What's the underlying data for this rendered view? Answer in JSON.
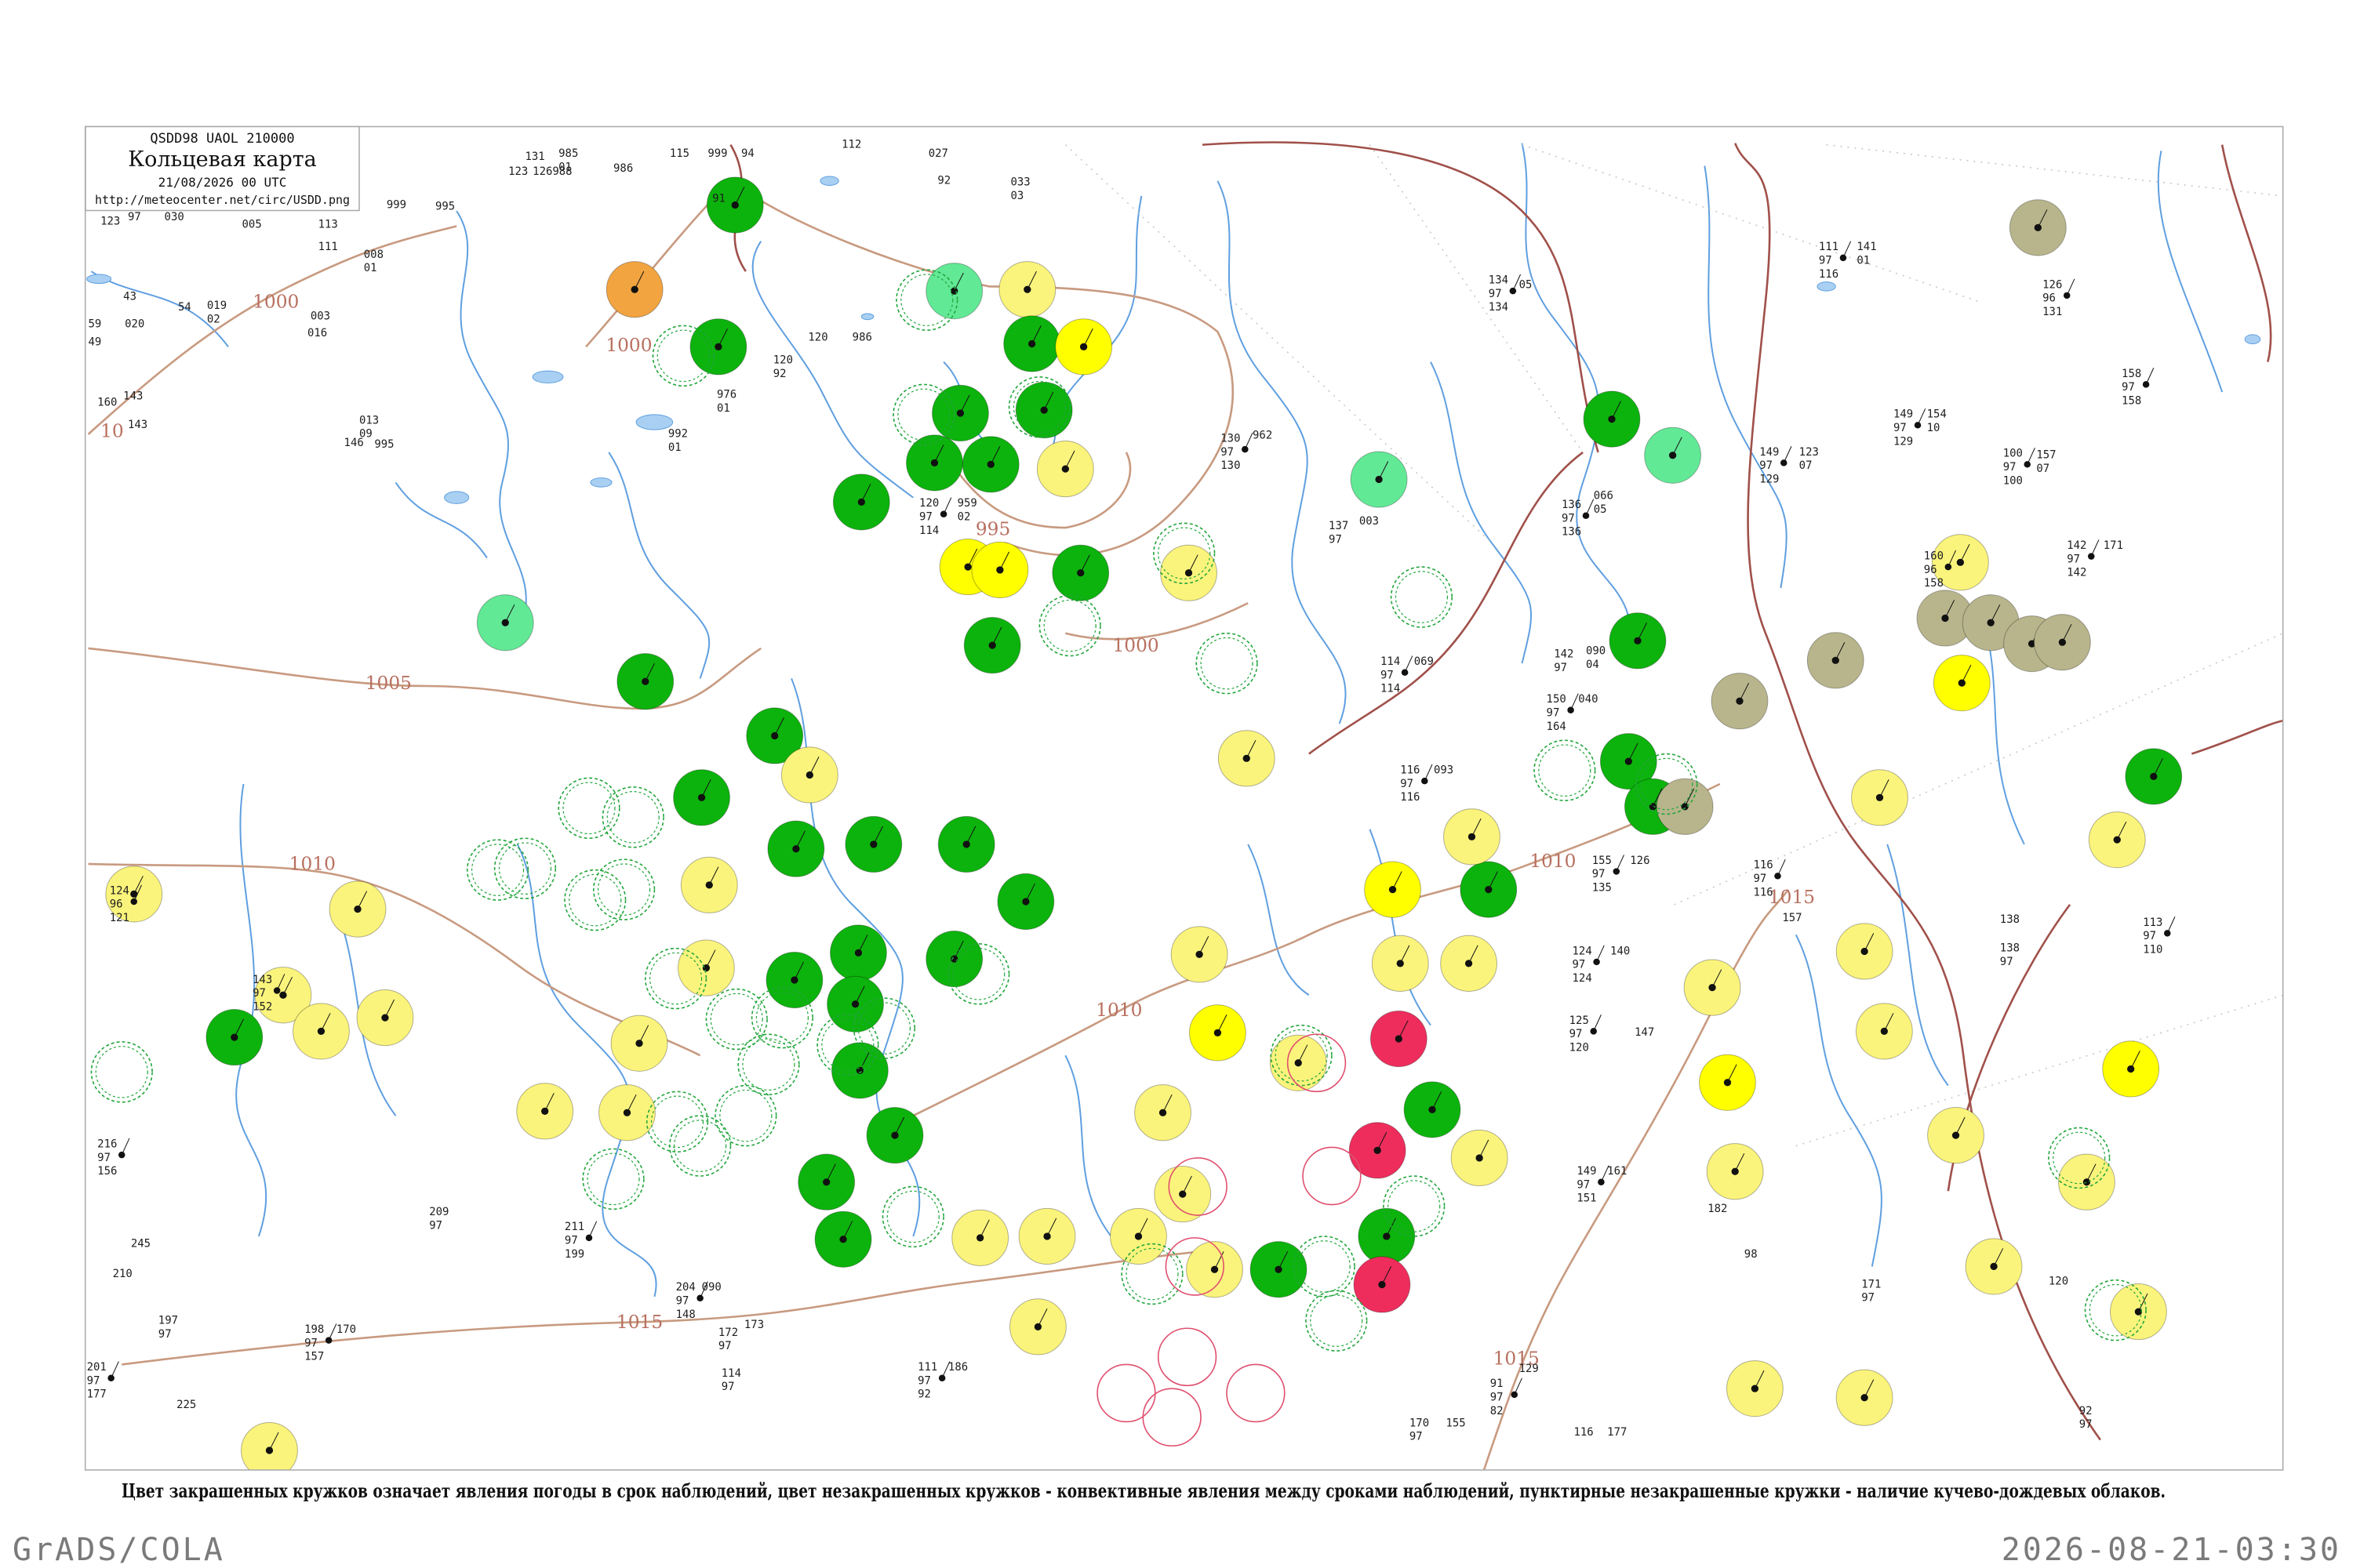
{
  "header": {
    "code": "QSDD98 UAOL 210000",
    "title": "Кольцевая карта",
    "date": "21/08/2026 00 UTC",
    "url": "http://meteocenter.net/circ/USDD.png"
  },
  "caption": "Цвет закрашенных кружков означает явления погоды в срок наблюдений, цвет незакрашенных кружков - конвективные явления между сроками наблюдений, пунктирные незакрашенные кружки - наличие кучево-дождевых облаков.",
  "footer": {
    "left": "GrADS/COLA",
    "right": "2026-08-21-03:30"
  },
  "colors": {
    "green": "#0cb30c",
    "lightgreen": "#62e996",
    "yellow": "#fbf47c",
    "bright": "#ffff00",
    "orange": "#f2a440",
    "red": "#ee2d5c",
    "olive": "#b8b58c",
    "dashed_green": "#22a63c",
    "open_red": "#e05070",
    "isobar": "#b87060"
  },
  "isobar_labels": [
    "1000",
    "10",
    "1000",
    "1005",
    "1010",
    "995",
    "1000",
    "1010",
    "1015",
    "1010",
    "1015",
    "1015"
  ],
  "filled_markers": [
    "green",
    "orange",
    "green",
    "lightgreen",
    "yellow",
    "green",
    "bright",
    "green",
    "green",
    "green",
    "green",
    "yellow",
    "green",
    "bright",
    "bright",
    "green",
    "green",
    "lightgreen",
    "green",
    "green",
    "green",
    "yellow",
    "green",
    "green",
    "green",
    "green",
    "green",
    "green",
    "green",
    "green",
    "green",
    "green",
    "green",
    "green",
    "yellow",
    "yellow",
    "yellow",
    "yellow",
    "yellow",
    "yellow",
    "yellow",
    "yellow",
    "green",
    "yellow",
    "yellow",
    "green",
    "lightgreen",
    "lightgreen",
    "olive",
    "yellow",
    "olive",
    "olive",
    "olive",
    "olive",
    "olive",
    "olive",
    "bright",
    "green",
    "green",
    "green",
    "olive",
    "green",
    "bright",
    "bright",
    "yellow",
    "yellow",
    "yellow",
    "yellow",
    "yellow",
    "yellow",
    "yellow",
    "yellow",
    "yellow",
    "green",
    "bright",
    "yellow",
    "yellow",
    "red",
    "red",
    "green",
    "green",
    "red",
    "green",
    "bright",
    "yellow",
    "yellow",
    "yellow",
    "yellow",
    "yellow",
    "yellow",
    "yellow",
    "yellow",
    "yellow",
    "yellow",
    "yellow",
    "yellow",
    "yellow",
    "yellow",
    "yellow",
    "yellow",
    "yellow"
  ],
  "open_markers": [
    "dashed_green",
    "dashed_green",
    "dashed_green",
    "dashed_green",
    "dashed_green",
    "dashed_green",
    "dashed_green",
    "dashed_green",
    "dashed_green",
    "dashed_green",
    "dashed_green",
    "dashed_green",
    "dashed_green",
    "dashed_green",
    "dashed_green",
    "dashed_green",
    "dashed_green",
    "dashed_green",
    "dashed_green",
    "dashed_green",
    "dashed_green",
    "dashed_green",
    "dashed_green",
    "dashed_green",
    "dashed_green",
    "dashed_green",
    "dashed_green",
    "dashed_green",
    "dashed_green",
    "dashed_green",
    "dashed_green",
    "dashed_green",
    "dashed_green",
    "dashed_green",
    "dashed_green",
    "dashed_green",
    "open_red",
    "open_red",
    "open_red",
    "open_red",
    "open_red",
    "open_red",
    "open_red",
    "open_red"
  ],
  "stations": [
    [
      "131"
    ],
    [
      "985",
      "01"
    ],
    [
      "123"
    ],
    [
      "126988"
    ],
    [
      "986"
    ],
    [
      "115"
    ],
    [
      "999"
    ],
    [
      "94"
    ],
    [
      "112"
    ],
    [
      "027"
    ],
    [
      "91"
    ],
    [
      "92"
    ],
    [
      "033",
      "03"
    ],
    [
      "123"
    ],
    [
      "97"
    ],
    [
      "030"
    ],
    [
      "008",
      "01"
    ],
    [
      "111"
    ],
    [
      "005"
    ],
    [
      "113"
    ],
    [
      "999"
    ],
    [
      "995"
    ],
    [
      "003"
    ],
    [
      "016"
    ],
    [
      "59"
    ],
    [
      "020"
    ],
    [
      "49"
    ],
    [
      "43"
    ],
    [
      "54"
    ],
    [
      "019",
      "02"
    ],
    [
      "160"
    ],
    [
      "143"
    ],
    [
      "143"
    ],
    [
      "013",
      "09"
    ],
    [
      "146"
    ],
    [
      "995"
    ],
    [
      "120"
    ],
    [
      "986"
    ],
    [
      "120",
      "92"
    ],
    [
      "976",
      "01"
    ],
    [
      "992",
      "01"
    ],
    [
      "120",
      "97",
      "114"
    ],
    [
      "959",
      "02"
    ],
    [
      "130",
      "97",
      "130"
    ],
    [
      "962"
    ],
    [
      "137",
      "97"
    ],
    [
      "003"
    ],
    [
      "136",
      "97",
      "136"
    ],
    [
      "066",
      "05"
    ],
    [
      "134",
      "97",
      "134"
    ],
    [
      "05"
    ],
    [
      "111",
      "97",
      "116"
    ],
    [
      "141",
      "01"
    ],
    [
      "126",
      "96",
      "131"
    ],
    [
      "149",
      "97",
      "129"
    ],
    [
      "154",
      "10"
    ],
    [
      "149",
      "97",
      "129"
    ],
    [
      "123",
      "07"
    ],
    [
      "100",
      "97",
      "100"
    ],
    [
      "157",
      "07"
    ],
    [
      "142",
      "97",
      "142"
    ],
    [
      "171"
    ],
    [
      "158",
      "97",
      "158"
    ],
    [
      "142",
      "97"
    ],
    [
      "090",
      "04"
    ],
    [
      "150",
      "97",
      "164"
    ],
    [
      "040"
    ],
    [
      "114",
      "97",
      "114"
    ],
    [
      "069"
    ],
    [
      "116",
      "97",
      "116"
    ],
    [
      "093"
    ],
    [
      "155",
      "97",
      "135"
    ],
    [
      "126"
    ],
    [
      "116",
      "97",
      "116"
    ],
    [
      "157"
    ],
    [
      "138"
    ],
    [
      "138",
      "97"
    ],
    [
      "113",
      "97",
      "110"
    ],
    [
      "124",
      "97",
      "124"
    ],
    [
      "140"
    ],
    [
      "125",
      "97",
      "120"
    ],
    [
      "147"
    ],
    [
      "149",
      "97",
      "151"
    ],
    [
      "161"
    ],
    [
      "182"
    ],
    [
      "98"
    ],
    [
      "171",
      "97"
    ],
    [
      "120"
    ],
    [
      "91",
      "97",
      "82"
    ],
    [
      "129"
    ],
    [
      "116"
    ],
    [
      "177"
    ],
    [
      "92",
      "97"
    ],
    [
      "170",
      "97"
    ],
    [
      "155"
    ],
    [
      "172",
      "97"
    ],
    [
      "173"
    ],
    [
      "114",
      "97"
    ],
    [
      "111",
      "97",
      "92"
    ],
    [
      "186"
    ],
    [
      "211",
      "97",
      "199"
    ],
    [
      "209",
      "97"
    ],
    [
      "216",
      "97",
      "156"
    ],
    [
      "245"
    ],
    [
      "210"
    ],
    [
      "197",
      "97"
    ],
    [
      "201",
      "97",
      "177"
    ],
    [
      "225"
    ],
    [
      "198",
      "97",
      "157"
    ],
    [
      "170"
    ],
    [
      "204",
      "97",
      "148"
    ],
    [
      "090"
    ],
    [
      "124",
      "96",
      "121"
    ],
    [
      "143",
      "97",
      "152"
    ],
    [
      "160",
      "96",
      "158"
    ]
  ]
}
